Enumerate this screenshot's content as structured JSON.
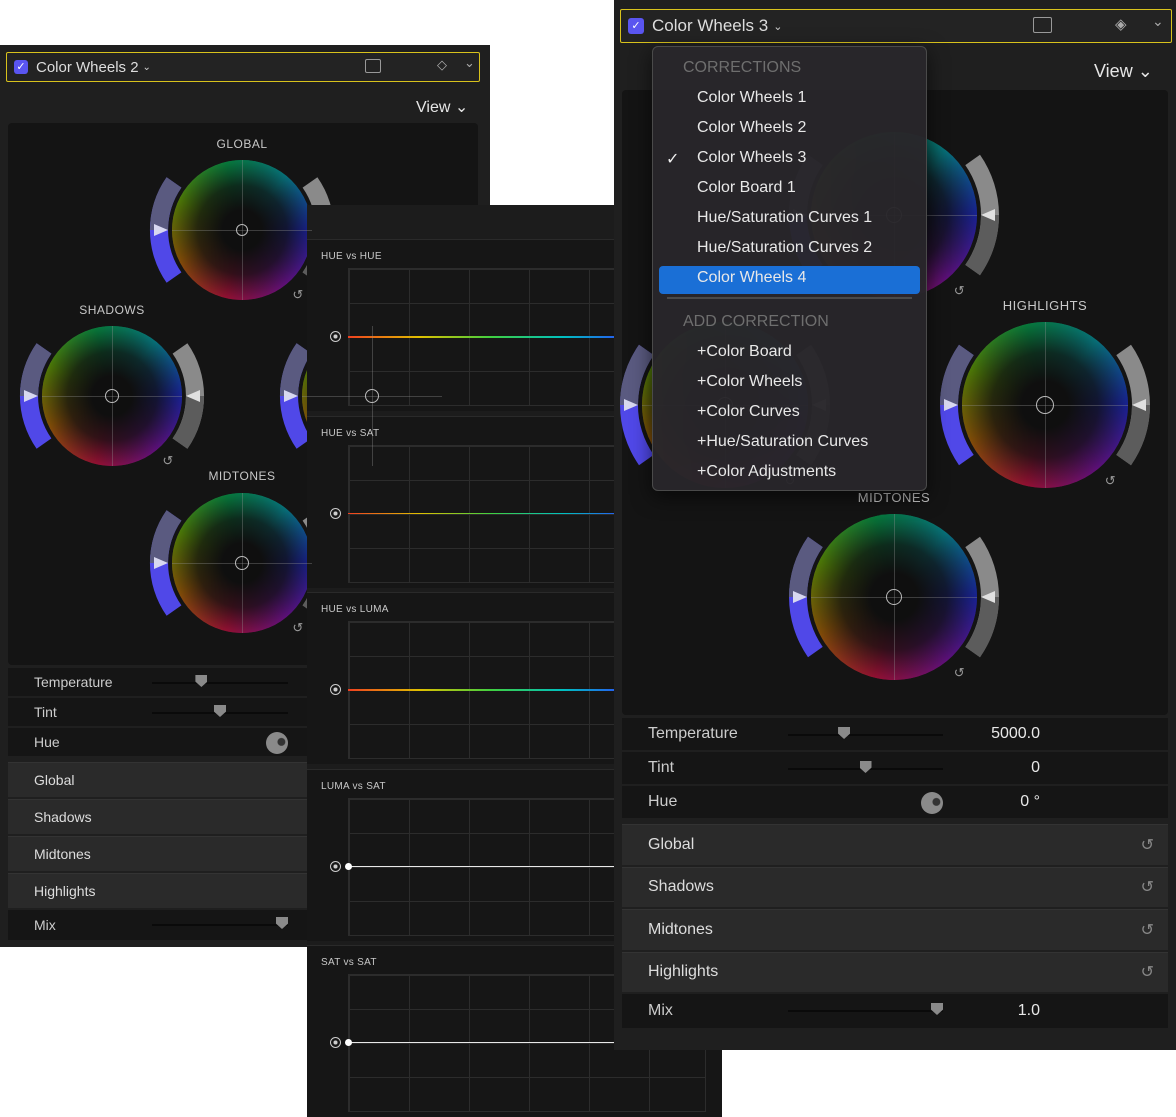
{
  "left": {
    "title": "Color Wheels 2",
    "view": "View",
    "wheels": {
      "global": "GLOBAL",
      "shadows": "SHADOWS",
      "midtones": "MIDTONES"
    },
    "controls": [
      {
        "label": "Temperature",
        "pos": 0.35
      },
      {
        "label": "Tint",
        "pos": 0.5
      },
      {
        "label": "Hue"
      }
    ],
    "sections": [
      "Global",
      "Shadows",
      "Midtones",
      "Highlights"
    ],
    "mix": {
      "label": "Mix",
      "pos": 1.0
    }
  },
  "middle": {
    "curves": [
      "HUE vs HUE",
      "HUE vs SAT",
      "HUE vs LUMA",
      "LUMA vs SAT",
      "SAT vs SAT"
    ]
  },
  "right": {
    "title": "Color Wheels 3",
    "view": "View",
    "wheels": {
      "highlights": "HIGHLIGHTS",
      "midtones": "MIDTONES"
    },
    "controls": [
      {
        "label": "Temperature",
        "value": "5000.0",
        "pos": 0.35
      },
      {
        "label": "Tint",
        "value": "0",
        "pos": 0.5
      },
      {
        "label": "Hue",
        "value": "0 °"
      }
    ],
    "sections": [
      "Global",
      "Shadows",
      "Midtones",
      "Highlights"
    ],
    "mix": {
      "label": "Mix",
      "value": "1.0",
      "pos": 1.0
    }
  },
  "menu": {
    "corrections_header": "CORRECTIONS",
    "corrections": [
      "Color Wheels 1",
      "Color Wheels 2",
      "Color Wheels 3",
      "Color Board 1",
      "Hue/Saturation Curves 1",
      "Hue/Saturation Curves 2",
      "Color Wheels 4"
    ],
    "checked": "Color Wheels 3",
    "highlighted": "Color Wheels 4",
    "add_header": "ADD CORRECTION",
    "add": [
      "+Color Board",
      "+Color Wheels",
      "+Color Curves",
      "+Hue/Saturation Curves",
      "+Color Adjustments"
    ],
    "highlight_color": "#1a6fd6"
  },
  "colors": {
    "accent_border": "#d8c21c",
    "checkbox": "#5a55f0"
  }
}
